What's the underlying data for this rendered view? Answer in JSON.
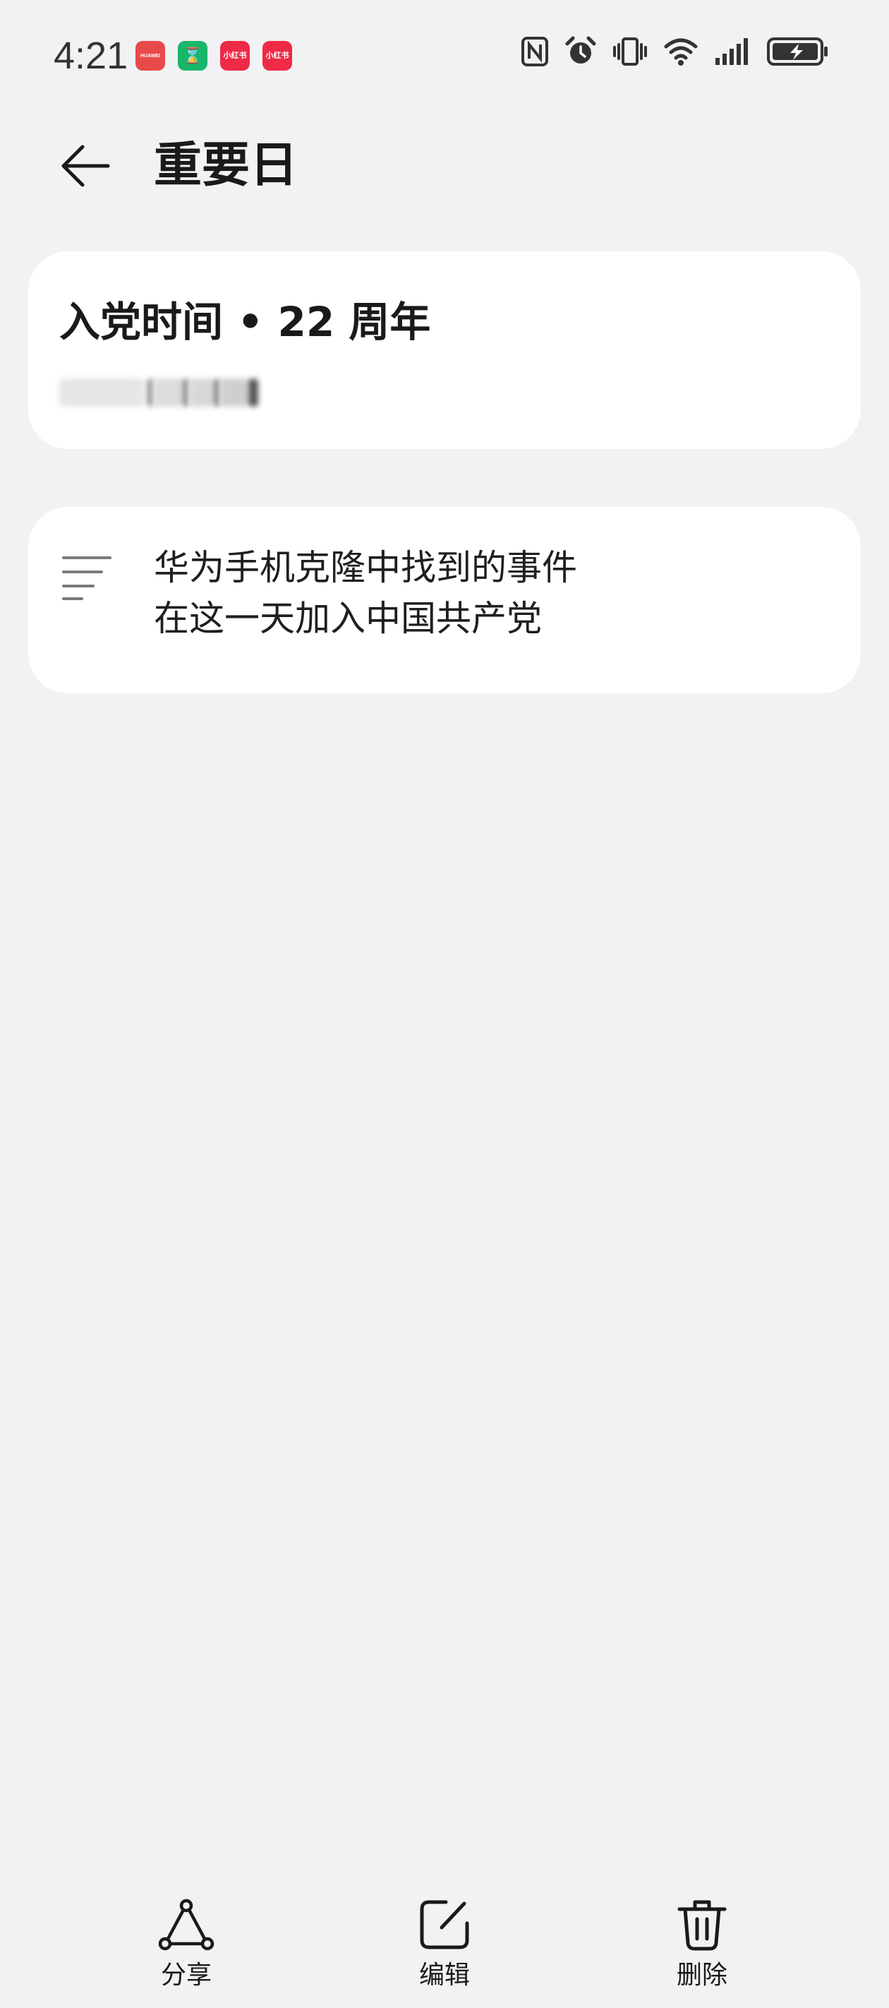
{
  "status_bar": {
    "time": "4:21",
    "notifications": [
      {
        "icon": "huawei-appgallery-icon",
        "label": "HUAWEI",
        "color": "#e84a4a"
      },
      {
        "icon": "hourglass-app-icon",
        "label": "⌛",
        "color": "#18b66a"
      },
      {
        "icon": "xiaohongshu-icon",
        "label": "小红书",
        "color": "#ee2a46"
      },
      {
        "icon": "xiaohongshu-icon",
        "label": "小红书",
        "color": "#ee2a46"
      }
    ],
    "system_icons": [
      "nfc-icon",
      "alarm-icon",
      "vibrate-icon",
      "wifi-icon",
      "signal-icon",
      "battery-charging-icon"
    ]
  },
  "header": {
    "back_icon": "arrow-left-icon",
    "title": "重要日"
  },
  "event": {
    "title": "入党时间 • 22 周年"
  },
  "note": {
    "icon": "notes-lines-icon",
    "lines": [
      "华为手机克隆中找到的事件",
      "在这一天加入中国共产党"
    ]
  },
  "toolbar": {
    "share_label": "分享",
    "edit_label": "编辑",
    "delete_label": "删除"
  },
  "colors": {
    "background": "#f1f2f4",
    "card": "#ffffff",
    "text": "#1a1a1a",
    "icon_gray": "#7a7a7a"
  }
}
